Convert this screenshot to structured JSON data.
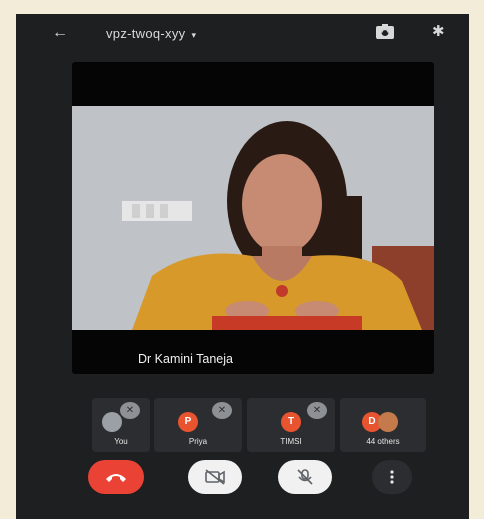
{
  "meeting": {
    "code": "vpz-twoq-xyy",
    "caret": "▾"
  },
  "icons": {
    "back": "back-arrow-icon",
    "switch_camera": "switch-camera-icon",
    "bluetooth": "bluetooth-icon",
    "end_call": "end-call-icon",
    "camera_off": "camera-off-icon",
    "mic_off": "mic-off-icon",
    "more": "more-icon"
  },
  "main_video": {
    "speaker_name": "Dr Kamini Taneja"
  },
  "participants": [
    {
      "label": "You",
      "initial": "",
      "avatar_color": "#9aa0a6"
    },
    {
      "label": "Priya",
      "initial": "P",
      "avatar_color": "#e8542f"
    },
    {
      "label": "TIMSI",
      "initial": "T",
      "avatar_color": "#e8542f"
    },
    {
      "label": "44 others",
      "initial": "D",
      "avatar_color": "#e8542f"
    }
  ],
  "colors": {
    "end_call": "#ea4335",
    "toggle_off_bg": "#f1f1f1",
    "surface": "#1e1f21",
    "tile_bg": "#2c2d30"
  }
}
